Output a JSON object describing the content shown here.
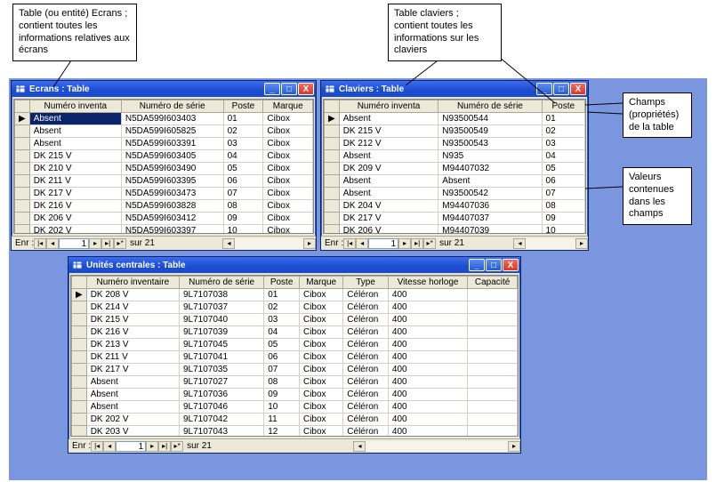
{
  "callouts": {
    "c1": "Table (ou entité) Ecrans ; contient toutes les informations relatives aux écrans",
    "c2": "Table claviers ; contient toutes les informations sur les claviers",
    "c3": "Champs (propriétés) de la table",
    "c4": "Valeurs contenues dans les champs"
  },
  "ecrans": {
    "title": "Ecrans : Table",
    "cols": [
      "Numéro inventa",
      "Numéro de série",
      "Poste",
      "Marque"
    ],
    "rows": [
      [
        "Absent",
        "N5DA599I603403",
        "01",
        "Cibox"
      ],
      [
        "Absent",
        "N5DA599I605825",
        "02",
        "Cibox"
      ],
      [
        "Absent",
        "N5DA599I603391",
        "03",
        "Cibox"
      ],
      [
        "DK 215 V",
        "N5DA599I603405",
        "04",
        "Cibox"
      ],
      [
        "DK 210 V",
        "N5DA599I603490",
        "05",
        "Cibox"
      ],
      [
        "DK 211 V",
        "N5DA599I603395",
        "06",
        "Cibox"
      ],
      [
        "DK 217 V",
        "N5DA599I603473",
        "07",
        "Cibox"
      ],
      [
        "DK 216 V",
        "N5DA599I603828",
        "08",
        "Cibox"
      ],
      [
        "DK 206 V",
        "N5DA599I603412",
        "09",
        "Cibox"
      ],
      [
        "DK 202 V",
        "N5DA599I603397",
        "10",
        "Cibox"
      ]
    ],
    "rec_label": "Enr :",
    "rec_num": "1",
    "rec_of": "sur 21"
  },
  "claviers": {
    "title": "Claviers : Table",
    "cols": [
      "Numéro inventa",
      "Numéro de série",
      "Poste"
    ],
    "rows": [
      [
        "Absent",
        "N93500544",
        "01"
      ],
      [
        "DK 215 V",
        "N93500549",
        "02"
      ],
      [
        "DK 212 V",
        "N93500543",
        "03"
      ],
      [
        "Absent",
        "N935",
        "04"
      ],
      [
        "DK 209 V",
        "M94407032",
        "05"
      ],
      [
        "Absent",
        "Absent",
        "06"
      ],
      [
        "Absent",
        "N93500542",
        "07"
      ],
      [
        "DK 204 V",
        "M94407036",
        "08"
      ],
      [
        "DK 217 V",
        "M94407037",
        "09"
      ],
      [
        "DK 206 V",
        "M94407039",
        "10"
      ]
    ],
    "rec_label": "Enr :",
    "rec_num": "1",
    "rec_of": "sur 21"
  },
  "unites": {
    "title": "Unités centrales : Table",
    "cols": [
      "Numéro inventaire",
      "Numéro de série",
      "Poste",
      "Marque",
      "Type",
      "Vitesse horloge",
      "Capacité"
    ],
    "rows": [
      [
        "DK 208 V",
        "9L7107038",
        "01",
        "Cibox",
        "Céléron",
        "400",
        ""
      ],
      [
        "DK 214 V",
        "9L7107037",
        "02",
        "Cibox",
        "Céléron",
        "400",
        ""
      ],
      [
        "DK 215 V",
        "9L7107040",
        "03",
        "Cibox",
        "Céléron",
        "400",
        ""
      ],
      [
        "DK 216 V",
        "9L7107039",
        "04",
        "Cibox",
        "Céléron",
        "400",
        ""
      ],
      [
        "DK 213 V",
        "9L7107045",
        "05",
        "Cibox",
        "Céléron",
        "400",
        ""
      ],
      [
        "DK 211 V",
        "9L7107041",
        "06",
        "Cibox",
        "Céléron",
        "400",
        ""
      ],
      [
        "DK 217 V",
        "9L7107035",
        "07",
        "Cibox",
        "Céléron",
        "400",
        ""
      ],
      [
        "Absent",
        "9L7107027",
        "08",
        "Cibox",
        "Céléron",
        "400",
        ""
      ],
      [
        "Absent",
        "9L7107036",
        "09",
        "Cibox",
        "Céléron",
        "400",
        ""
      ],
      [
        "Absent",
        "9L7107046",
        "10",
        "Cibox",
        "Céléron",
        "400",
        ""
      ],
      [
        "DK 202 V",
        "9L7107042",
        "11",
        "Cibox",
        "Céléron",
        "400",
        ""
      ],
      [
        "DK 203 V",
        "9L7107043",
        "12",
        "Cibox",
        "Céléron",
        "400",
        ""
      ]
    ],
    "rec_label": "Enr :",
    "rec_num": "1",
    "rec_of": "sur 21"
  },
  "icons": {
    "min": "_",
    "max": "□",
    "close": "X"
  },
  "nav": {
    "first": "|◂",
    "prev": "◂",
    "next": "▸",
    "last": "▸|",
    "new": "▸*"
  }
}
